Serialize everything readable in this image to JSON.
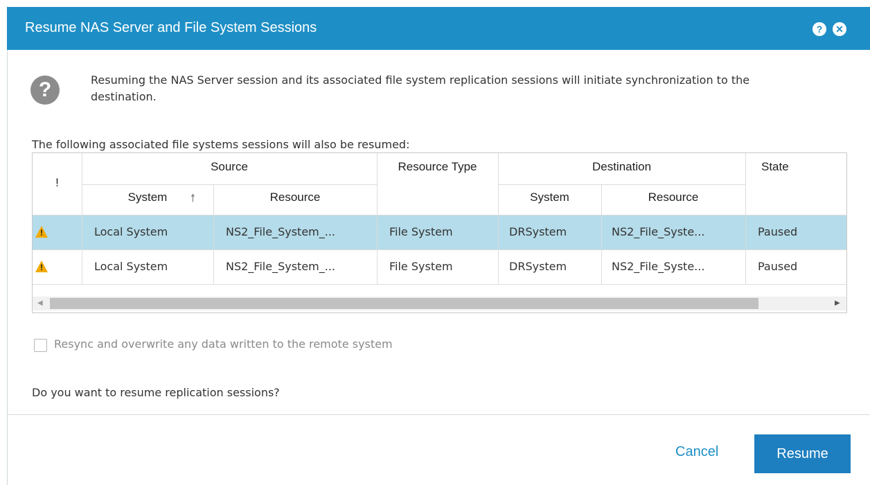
{
  "dialog": {
    "title": "Resume NAS Server and File System Sessions",
    "help_icon": "help-icon",
    "close_icon": "close-icon",
    "intro_text": "Resuming the NAS Server session and its associated file system replication sessions will initiate synchronization to the destination.",
    "table_intro": "The following associated file systems sessions will also be resumed:",
    "checkbox_label": "Resync and overwrite any data written to the remote system",
    "checkbox_checked": false,
    "confirm_text": "Do you want to resume replication sessions?",
    "cancel_label": "Cancel",
    "resume_label": "Resume"
  },
  "table": {
    "headers": {
      "alert": "!",
      "source": "Source",
      "resource_type": "Resource Type",
      "destination": "Destination",
      "state": "State",
      "src_system": "System",
      "src_resource": "Resource",
      "dst_system": "System",
      "dst_resource": "Resource"
    },
    "sort_icon": "arrow-up-icon",
    "rows": [
      {
        "alert_icon": "warning-icon",
        "src_system": "Local System",
        "src_resource": "NS2_File_System_...",
        "resource_type": "File System",
        "dst_system": "DRSystem",
        "dst_resource": "NS2_File_Syste...",
        "state": "Paused",
        "selected": true
      },
      {
        "alert_icon": "warning-icon",
        "src_system": "Local System",
        "src_resource": "NS2_File_System_...",
        "resource_type": "File System",
        "dst_system": "DRSystem",
        "dst_resource": "NS2_File_Syste...",
        "state": "Paused",
        "selected": false
      }
    ]
  },
  "colors": {
    "title_bar": "#1e8fc6",
    "primary_button": "#1e7fc0",
    "selected_row": "#b5dcea",
    "warning": "#f2a900"
  }
}
